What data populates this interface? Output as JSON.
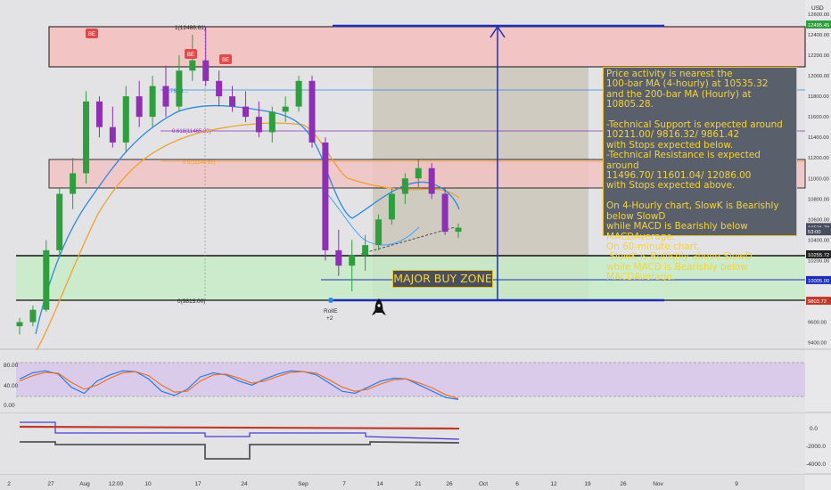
{
  "currency": "USD",
  "annotation_text": "Price activity is nearest the\n100-bar MA (4-hourly) at 10535.32\nand the 200-bar MA (Hourly) at 10805.28.\n\n-Technical Support is expected around\n10211.00/ 9816.32/ 9861.42\nwith Stops expected below.\n-Technical Resistance is expected around\n11496.70/ 11601.04/ 12086.00\nwith Stops expected above.\n\nOn 4-Hourly chart, SlowK is Bearishly below SlowD\nwhile MACD is Bearishly below MACDAverage.\nOn 60-minute chart,\n SlowK is Bullishly above SlowD\nwhile MACD is Bearishly below MACDAverage.",
  "buy_zone_label": "MAJOR BUY ZONE",
  "be_badge": "BE",
  "fib_top_label": "1(12486.61)",
  "fib_bottom_label": "0(9813.00)",
  "fib_labels": [
    "0.786(1...",
    "0.618(11465.29)",
    "0.5(11149.81)"
  ],
  "event_label": "RollE",
  "event_count": "+2",
  "colors": {
    "up": "#2e9e3f",
    "down": "#8e2fb5",
    "ma_blue": "#2b8ae0",
    "ma_orange": "#f0a030",
    "resistance_fill": "#f2c4c4",
    "support_fill": "#c8ecc8",
    "gray_fill": "#c9c3b3",
    "blue_line": "#1c2eb8",
    "macd_red": "#c0392b",
    "stoch_blue": "#2b7be0",
    "stoch_orange": "#e8732a"
  },
  "chart_data": {
    "type": "candlestick",
    "y_price_ticks": [
      "12600.00",
      "12400.00",
      "12200.00",
      "12000.00",
      "11800.00",
      "11600.00",
      "11400.00",
      "11200.00",
      "11000.00",
      "10800.00",
      "10600.00",
      "10400.00",
      "10200.00",
      "10000.00",
      "9800.00",
      "9600.00",
      "9400.00"
    ],
    "price_badges": [
      {
        "label": "12495.45",
        "value": 12495.45,
        "color": "#2e9e3f"
      },
      {
        "label": "10521.79",
        "value": 10521.79,
        "color": "#4a4f60"
      },
      {
        "label": "53:00",
        "value": 10480,
        "color": "#4a4f60"
      },
      {
        "label": "10255.72",
        "value": 10255.72,
        "color": "#222222"
      },
      {
        "label": "10005.00",
        "value": 10005.0,
        "color": "#1c2eb8"
      },
      {
        "label": "9803.72",
        "value": 9803.72,
        "color": "#c0392b"
      }
    ],
    "x_ticks": [
      "2",
      "27",
      "Aug",
      "12:00",
      "10",
      "17",
      "24",
      "Sep",
      "7",
      "14",
      "21",
      "26",
      "Oct",
      "6",
      "12",
      "19",
      "26",
      "Nov",
      "9"
    ],
    "stoch_ticks": [
      "80.00",
      "40.00",
      "0.00"
    ],
    "macd_ticks": [
      "0.0",
      "-2000.0",
      "-4000.0"
    ],
    "levels": [
      12486.61,
      12086.0,
      11601.04,
      11465.29,
      11149.81,
      10805.28,
      10255.72,
      10005.0,
      9813.0
    ],
    "zones": [
      {
        "name": "resistance-upper",
        "from": 12086,
        "to": 12486.61
      },
      {
        "name": "resistance-lower",
        "from": 10900,
        "to": 11180
      },
      {
        "name": "support",
        "from": 9813,
        "to": 10255.72
      }
    ],
    "target_price": 12486.61,
    "ohlc_sample": [
      [
        9560,
        9640,
        9480,
        9600
      ],
      [
        9600,
        9760,
        9560,
        9720
      ],
      [
        9720,
        10400,
        9700,
        10300
      ],
      [
        10300,
        10900,
        10250,
        10850
      ],
      [
        10850,
        11200,
        10700,
        11050
      ],
      [
        11050,
        11850,
        10950,
        11750
      ],
      [
        11750,
        11800,
        11400,
        11500
      ],
      [
        11500,
        11700,
        11300,
        11350
      ],
      [
        11350,
        11900,
        11250,
        11800
      ],
      [
        11800,
        11950,
        11500,
        11600
      ],
      [
        11600,
        12000,
        11500,
        11900
      ],
      [
        11900,
        12100,
        11600,
        11700
      ],
      [
        11700,
        12200,
        11650,
        12050
      ],
      [
        12050,
        12400,
        11950,
        12150
      ],
      [
        12150,
        12480,
        11900,
        11950
      ],
      [
        11950,
        12050,
        11700,
        11800
      ],
      [
        11800,
        11900,
        11650,
        11700
      ],
      [
        11700,
        11850,
        11550,
        11600
      ],
      [
        11600,
        11750,
        11400,
        11450
      ],
      [
        11450,
        11700,
        11350,
        11650
      ],
      [
        11650,
        11800,
        11550,
        11700
      ],
      [
        11700,
        12000,
        11650,
        11950
      ],
      [
        11950,
        12000,
        11300,
        11350
      ],
      [
        11350,
        11400,
        10200,
        10300
      ],
      [
        10300,
        10500,
        10050,
        10150
      ],
      [
        10150,
        10400,
        9900,
        10250
      ],
      [
        10250,
        10450,
        10100,
        10350
      ],
      [
        10350,
        10650,
        10300,
        10600
      ],
      [
        10600,
        10900,
        10550,
        10850
      ],
      [
        10850,
        11050,
        10750,
        11000
      ],
      [
        11000,
        11180,
        10900,
        11100
      ],
      [
        11100,
        11150,
        10800,
        10850
      ],
      [
        10850,
        10900,
        10450,
        10480
      ],
      [
        10480,
        10560,
        10420,
        10520
      ]
    ],
    "stoch_k": [
      60,
      75,
      80,
      72,
      40,
      25,
      55,
      70,
      80,
      78,
      60,
      30,
      20,
      35,
      65,
      75,
      70,
      55,
      45,
      60,
      72,
      80,
      78,
      70,
      50,
      30,
      25,
      40,
      55,
      62,
      60,
      45,
      30,
      15,
      10
    ],
    "stoch_d": [
      55,
      68,
      76,
      74,
      52,
      35,
      45,
      62,
      75,
      78,
      68,
      45,
      28,
      30,
      55,
      70,
      72,
      62,
      50,
      55,
      66,
      76,
      78,
      74,
      58,
      40,
      30,
      35,
      48,
      58,
      60,
      50,
      38,
      22,
      12
    ]
  }
}
